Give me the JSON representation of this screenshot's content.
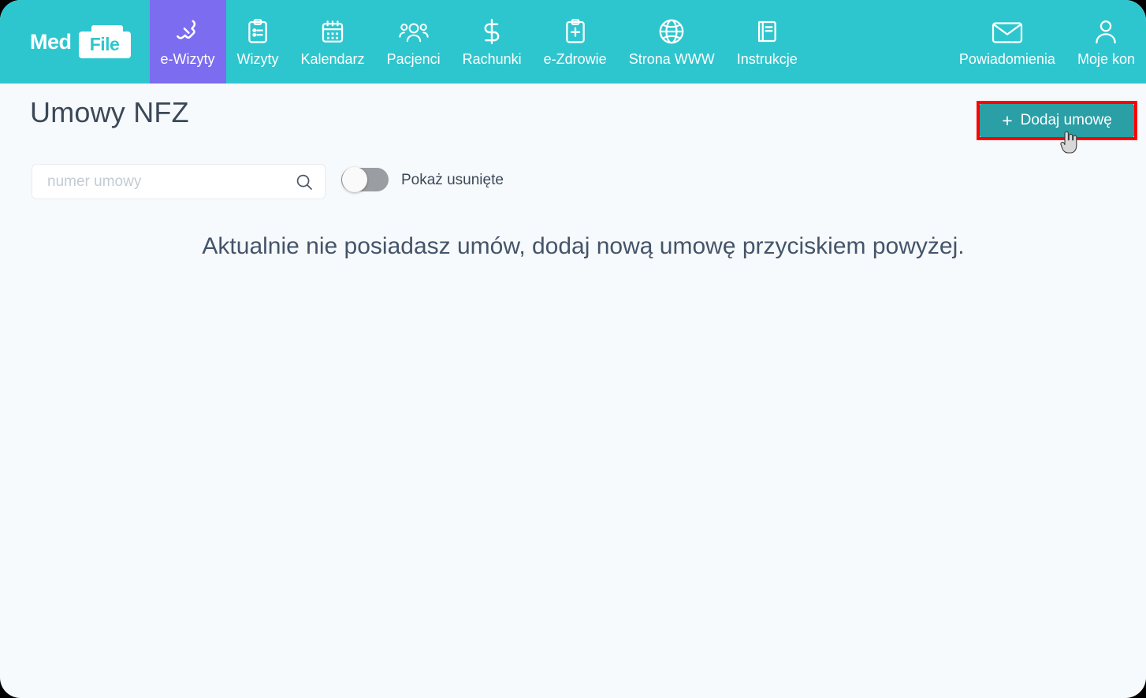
{
  "window": {
    "background_color": "#f7fafc",
    "outer_color": "#000000"
  },
  "topnav": {
    "background_color": "#2ec6ce",
    "active_color": "#7c6cf0",
    "brand": {
      "text_primary": "Med",
      "text_secondary": "File"
    },
    "items": [
      {
        "label": "e-Wizyty",
        "icon": "phone-call-icon",
        "active": true
      },
      {
        "label": "Wizyty",
        "icon": "clipboard-list-icon",
        "active": false
      },
      {
        "label": "Kalendarz",
        "icon": "calendar-icon",
        "active": false
      },
      {
        "label": "Pacjenci",
        "icon": "users-group-icon",
        "active": false
      },
      {
        "label": "Rachunki",
        "icon": "dollar-sign-icon",
        "active": false
      },
      {
        "label": "e-Zdrowie",
        "icon": "clipboard-plus-icon",
        "active": false
      },
      {
        "label": "Strona WWW",
        "icon": "globe-icon",
        "active": false
      },
      {
        "label": "Instrukcje",
        "icon": "book-icon",
        "active": false
      }
    ],
    "right_items": [
      {
        "label": "Powiadomienia",
        "icon": "envelope-icon"
      },
      {
        "label": "Moje kon",
        "icon": "user-account-icon"
      }
    ]
  },
  "header": {
    "title": "Umowy NFZ",
    "add_button": {
      "label": "Dodaj umowę",
      "plus": "+",
      "background_color": "#2a9fa5",
      "highlight_color": "#ff0000",
      "highlighted": true
    }
  },
  "filters": {
    "search": {
      "placeholder": "numer umowy",
      "value": "",
      "icon": "search-icon"
    },
    "show_deleted": {
      "label": "Pokaż usunięte",
      "state": "off",
      "track_color": "#9a9da1"
    }
  },
  "content": {
    "empty_message": "Aktualnie nie posiadasz umów, dodaj nową umowę przyciskiem powyżej."
  }
}
